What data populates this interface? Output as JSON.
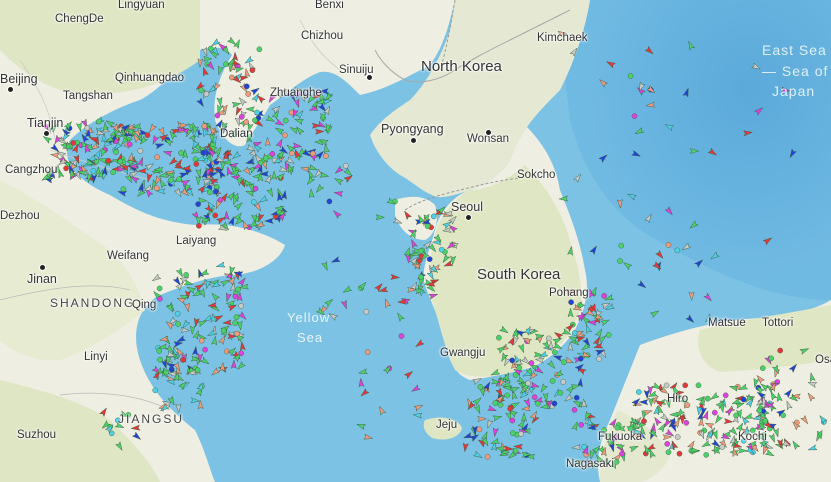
{
  "map": {
    "countries": [
      {
        "name": "North Korea",
        "id": "north-korea"
      },
      {
        "name": "South Korea",
        "id": "south-korea"
      }
    ],
    "regions": [
      {
        "name": "SHANDONG",
        "id": "shandong"
      },
      {
        "name": "JIANGSU",
        "id": "jiangsu"
      }
    ],
    "seas": [
      {
        "name": "East Sea",
        "id": "east-sea"
      },
      {
        "name": "— Sea of",
        "id": "sea-of"
      },
      {
        "name": "Japan",
        "id": "japan"
      },
      {
        "name": "Yellow",
        "id": "yellow"
      },
      {
        "name": "Sea",
        "id": "sea"
      }
    ],
    "cities": [
      {
        "name": "ChengDe",
        "id": "chengde"
      },
      {
        "name": "Lingyuan",
        "id": "lingyuan"
      },
      {
        "name": "Benxi",
        "id": "benxi"
      },
      {
        "name": "Kimchaek",
        "id": "kimchaek"
      },
      {
        "name": "Beijing",
        "id": "beijing"
      },
      {
        "name": "Qinhuangdao",
        "id": "qinhuangdao"
      },
      {
        "name": "Tangshan",
        "id": "tangshan"
      },
      {
        "name": "Tianjin",
        "id": "tianjin"
      },
      {
        "name": "Cangzhou",
        "id": "cangzhou"
      },
      {
        "name": "Sinuiju",
        "id": "sinuiju"
      },
      {
        "name": "Zhuanghe",
        "id": "zhuanghe"
      },
      {
        "name": "Dalian",
        "id": "dalian"
      },
      {
        "name": "Pyongyang",
        "id": "pyongyang"
      },
      {
        "name": "Wonsan",
        "id": "wonsan"
      },
      {
        "name": "Sokcho",
        "id": "sokcho"
      },
      {
        "name": "Seoul",
        "id": "seoul"
      },
      {
        "name": "Dezhou",
        "id": "dezhou"
      },
      {
        "name": "Laiyang",
        "id": "laiyang"
      },
      {
        "name": "Weifang",
        "id": "weifang"
      },
      {
        "name": "Jinan",
        "id": "jinan"
      },
      {
        "name": "Pohang",
        "id": "pohang"
      },
      {
        "name": "Linyi",
        "id": "linyi"
      },
      {
        "name": "Gwangju",
        "id": "gwangju"
      },
      {
        "name": "Suzhou",
        "id": "suzhou"
      },
      {
        "name": "Jeju",
        "id": "jeju"
      },
      {
        "name": "Hiroshima",
        "id": "hiroshima"
      },
      {
        "name": "Matsue",
        "id": "matsue"
      },
      {
        "name": "Tottori",
        "id": "tottori"
      },
      {
        "name": "Fukuoka",
        "id": "fukuoka"
      },
      {
        "name": "Kochi",
        "id": "kochi"
      },
      {
        "name": "Nagasaki",
        "id": "nagasaki"
      },
      {
        "name": "Osaka",
        "id": "osaka"
      },
      {
        "name": "Hiro",
        "id": "hiro"
      },
      {
        "name": "Chizhou",
        "id": "chizhou"
      },
      {
        "name": "Qing",
        "id": "qing"
      }
    ],
    "colors": {
      "sea": "#7cc2e4",
      "deep_sea": "#58a9da",
      "land": "#eeeee2",
      "land_green": "#dfe6c4",
      "border": "#999999",
      "ship_cargo": "#4cd16a",
      "ship_tanker": "#e3373b",
      "ship_passenger": "#2343d8",
      "ship_tug": "#4dd0e8",
      "ship_fishing": "#f29a7f",
      "ship_other": "#c9c9c9",
      "ship_pleasure": "#e040e0"
    }
  }
}
